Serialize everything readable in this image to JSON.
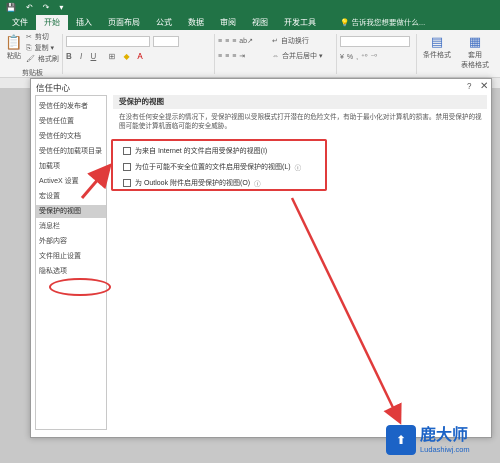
{
  "titlebar": {
    "items": [
      "💾",
      "↶",
      "↷",
      "▾"
    ]
  },
  "ribbon": {
    "tabs": [
      "文件",
      "开始",
      "插入",
      "页面布局",
      "公式",
      "数据",
      "审阅",
      "视图",
      "开发工具"
    ],
    "tell_me": "告诉我您想要做什么...",
    "clipboard": {
      "cut": "剪切",
      "copy": "复制 ▾",
      "format_painter": "格式刷",
      "paste": "粘贴",
      "group": "剪贴板"
    },
    "wrap_text": "自动换行",
    "merge_center": "合并后居中 ▾",
    "conditional_format": "条件格式",
    "apply": "套用",
    "table_format": "表格格式"
  },
  "dialog": {
    "title": "信任中心",
    "help": "?",
    "close": "✕",
    "nav_items": [
      "受信任的发布者",
      "受信任位置",
      "受信任的文档",
      "受信任的加载项目录",
      "加载项",
      "ActiveX 设置",
      "宏设置",
      "受保护的视图",
      "消息栏",
      "外部内容",
      "文件阻止设置",
      "隐私选项"
    ],
    "selected_index": 7,
    "section_title": "受保护的视图",
    "description": "在没有任何安全提示的情况下，受保护视图以受限模式打开潜在的危险文件，有助于最小化对计算机的损害。禁用受保护的视图可能使计算机面临可能的安全威胁。",
    "options": [
      {
        "label": "为来自 Internet 的文件启用受保护的视图(I)",
        "checked": false,
        "info": ""
      },
      {
        "label": "为位于可能不安全位置的文件启用受保护的视图(L)",
        "checked": false,
        "info": "ⓘ"
      },
      {
        "label": "为 Outlook 附件启用受保护的视图(O)",
        "checked": false,
        "info": "ⓘ"
      }
    ]
  },
  "colors": {
    "excel_green": "#217346",
    "annotation_red": "#e03b3b",
    "watermark_blue": "#1c63c6"
  },
  "watermark": {
    "main": "鹿大师",
    "sub": "Ludashiwj.com"
  }
}
